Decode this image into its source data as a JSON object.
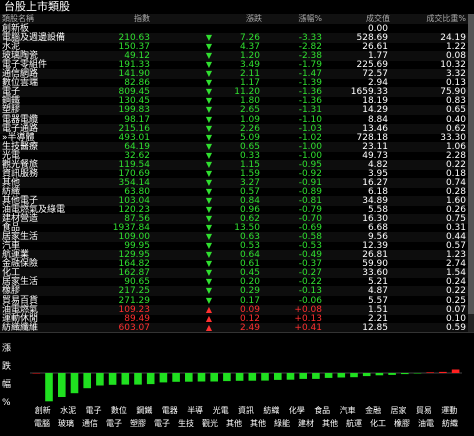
{
  "window": {
    "title": "台股上市類股"
  },
  "columns": {
    "name": "類股名稱",
    "index": "指數",
    "change": "漲跌",
    "pct": "漲幅%",
    "volume": "成交值",
    "ratio": "成交比重%"
  },
  "rows": [
    {
      "name": "創新板",
      "index": "",
      "dir": "",
      "change": "",
      "pct": "",
      "volume": "0.00",
      "ratio": ""
    },
    {
      "name": "電腦及週邊設備",
      "index": "210.63",
      "dir": "down",
      "change": "7.26",
      "pct": "-3.33",
      "volume": "528.69",
      "ratio": "24.19"
    },
    {
      "name": "水泥",
      "index": "150.37",
      "dir": "down",
      "change": "4.37",
      "pct": "-2.82",
      "volume": "26.61",
      "ratio": "1.22"
    },
    {
      "name": "玻璃陶瓷",
      "index": "49.12",
      "dir": "down",
      "change": "1.20",
      "pct": "-2.38",
      "volume": "1.77",
      "ratio": "0.08"
    },
    {
      "name": "電子零組件",
      "index": "191.33",
      "dir": "down",
      "change": "3.49",
      "pct": "-1.79",
      "volume": "225.69",
      "ratio": "10.32"
    },
    {
      "name": "通信網路",
      "index": "141.90",
      "dir": "down",
      "change": "2.11",
      "pct": "-1.47",
      "volume": "72.57",
      "ratio": "3.32"
    },
    {
      "name": "數位雲端",
      "index": "82.86",
      "dir": "down",
      "change": "1.17",
      "pct": "-1.39",
      "volume": "2.94",
      "ratio": "0.13"
    },
    {
      "name": "電子",
      "index": "809.45",
      "dir": "down",
      "change": "11.20",
      "pct": "-1.36",
      "volume": "1659.33",
      "ratio": "75.90"
    },
    {
      "name": "鋼鐵",
      "index": "130.45",
      "dir": "down",
      "change": "1.80",
      "pct": "-1.36",
      "volume": "18.19",
      "ratio": "0.83"
    },
    {
      "name": "塑膠",
      "index": "199.83",
      "dir": "down",
      "change": "2.65",
      "pct": "-1.31",
      "volume": "14.29",
      "ratio": "0.65"
    },
    {
      "name": "電器電纜",
      "index": "98.17",
      "dir": "down",
      "change": "1.09",
      "pct": "-1.10",
      "volume": "8.84",
      "ratio": "0.40"
    },
    {
      "name": "電子通路",
      "index": "215.16",
      "dir": "down",
      "change": "2.26",
      "pct": "-1.03",
      "volume": "13.46",
      "ratio": "0.62"
    },
    {
      "name": "»半導體",
      "index": "493.01",
      "dir": "down",
      "change": "5.09",
      "pct": "-1.02",
      "volume": "728.18",
      "ratio": "33.30"
    },
    {
      "name": "生技醫療",
      "index": "64.19",
      "dir": "down",
      "change": "0.65",
      "pct": "-1.00",
      "volume": "23.11",
      "ratio": "1.06"
    },
    {
      "name": "光電",
      "index": "32.62",
      "dir": "down",
      "change": "0.33",
      "pct": "-1.00",
      "volume": "49.73",
      "ratio": "2.28"
    },
    {
      "name": "觀光餐旅",
      "index": "119.54",
      "dir": "down",
      "change": "1.15",
      "pct": "-0.95",
      "volume": "4.82",
      "ratio": "0.22"
    },
    {
      "name": "資訊服務",
      "index": "170.69",
      "dir": "down",
      "change": "1.59",
      "pct": "-0.92",
      "volume": "3.95",
      "ratio": "0.18"
    },
    {
      "name": "其他",
      "index": "354.14",
      "dir": "down",
      "change": "3.27",
      "pct": "-0.91",
      "volume": "16.27",
      "ratio": "0.74"
    },
    {
      "name": "紡織",
      "index": "63.80",
      "dir": "down",
      "change": "0.57",
      "pct": "-0.89",
      "volume": "6.18",
      "ratio": "0.28"
    },
    {
      "name": "其他電子",
      "index": "103.04",
      "dir": "down",
      "change": "0.84",
      "pct": "-0.81",
      "volume": "34.89",
      "ratio": "1.60"
    },
    {
      "name": "油電燃氣及綠電",
      "index": "120.23",
      "dir": "down",
      "change": "0.96",
      "pct": "-0.79",
      "volume": "5.58",
      "ratio": "0.26"
    },
    {
      "name": "建材營造",
      "index": "87.56",
      "dir": "down",
      "change": "0.62",
      "pct": "-0.70",
      "volume": "16.30",
      "ratio": "0.75"
    },
    {
      "name": "食品",
      "index": "1937.84",
      "dir": "down",
      "change": "13.50",
      "pct": "-0.69",
      "volume": "6.68",
      "ratio": "0.31"
    },
    {
      "name": "居家生活",
      "index": "109.00",
      "dir": "down",
      "change": "0.63",
      "pct": "-0.58",
      "volume": "9.56",
      "ratio": "0.44"
    },
    {
      "name": "汽車",
      "index": "99.95",
      "dir": "down",
      "change": "0.53",
      "pct": "-0.53",
      "volume": "12.39",
      "ratio": "0.57"
    },
    {
      "name": "航運業",
      "index": "129.95",
      "dir": "down",
      "change": "0.64",
      "pct": "-0.49",
      "volume": "26.81",
      "ratio": "1.23"
    },
    {
      "name": "金融保險",
      "index": "164.82",
      "dir": "down",
      "change": "0.61",
      "pct": "-0.37",
      "volume": "59.90",
      "ratio": "2.74"
    },
    {
      "name": "化工",
      "index": "162.87",
      "dir": "down",
      "change": "0.45",
      "pct": "-0.27",
      "volume": "33.60",
      "ratio": "1.54"
    },
    {
      "name": "居家生活",
      "index": "90.65",
      "dir": "down",
      "change": "0.20",
      "pct": "-0.22",
      "volume": "5.21",
      "ratio": "0.24"
    },
    {
      "name": "橡膠",
      "index": "217.25",
      "dir": "down",
      "change": "0.29",
      "pct": "-0.13",
      "volume": "4.87",
      "ratio": "0.22"
    },
    {
      "name": "貿易百貨",
      "index": "271.29",
      "dir": "down",
      "change": "0.17",
      "pct": "-0.06",
      "volume": "5.57",
      "ratio": "0.25"
    },
    {
      "name": "油電燃氣",
      "index": "109.23",
      "dir": "up",
      "change": "0.09",
      "pct": "+0.08",
      "volume": "1.51",
      "ratio": "0.07"
    },
    {
      "name": "運動休閒",
      "index": "89.49",
      "dir": "up",
      "change": "0.12",
      "pct": "+0.13",
      "volume": "2.21",
      "ratio": "0.10"
    },
    {
      "name": "紡織纖維",
      "index": "603.07",
      "dir": "up",
      "change": "2.49",
      "pct": "+0.41",
      "volume": "12.85",
      "ratio": "0.59"
    }
  ],
  "chart": {
    "ylabel": [
      "漲",
      "跌",
      "幅",
      "%"
    ],
    "colors": {
      "up": "#ff2020",
      "down": "#20e020"
    }
  },
  "chart_data": {
    "type": "bar",
    "categories": [
      "創新",
      "電腦",
      "水泥",
      "玻璃",
      "通信",
      "電子",
      "數位",
      "電子",
      "鋼鐵",
      "塑膠",
      "電器",
      "半導",
      "電子",
      "生技",
      "光電",
      "觀光",
      "資訊",
      "其他",
      "紡織",
      "化學",
      "建材",
      "食品",
      "其他",
      "汽車",
      "航運",
      "金融",
      "化工",
      "居家",
      "橡膠",
      "貿易",
      "油電",
      "運動",
      "紡織"
    ],
    "labels_top": [
      "創新",
      "水泥",
      "電子",
      "數位",
      "鋼鐵",
      "電器",
      "半導",
      "光電",
      "資訊",
      "紡織",
      "化學",
      "食品",
      "汽車",
      "金融",
      "居家",
      "貿易",
      "運動"
    ],
    "labels_bottom": [
      "電腦",
      "玻璃",
      "通信",
      "電子",
      "塑膠",
      "電子",
      "生技",
      "觀光",
      "其他",
      "其他",
      "綠能",
      "建材",
      "其他",
      "航運",
      "化工",
      "橡膠",
      "油電",
      "紡織"
    ],
    "values": [
      0.0,
      -3.33,
      -2.82,
      -2.38,
      -1.79,
      -1.47,
      -1.39,
      -1.36,
      -1.36,
      -1.31,
      -1.1,
      -1.03,
      -1.02,
      -1.0,
      -1.0,
      -0.95,
      -0.92,
      -0.91,
      -0.89,
      -0.81,
      -0.79,
      -0.7,
      -0.69,
      -0.58,
      -0.53,
      -0.49,
      -0.37,
      -0.27,
      -0.22,
      -0.13,
      -0.06,
      0.08,
      0.13,
      0.41
    ]
  }
}
